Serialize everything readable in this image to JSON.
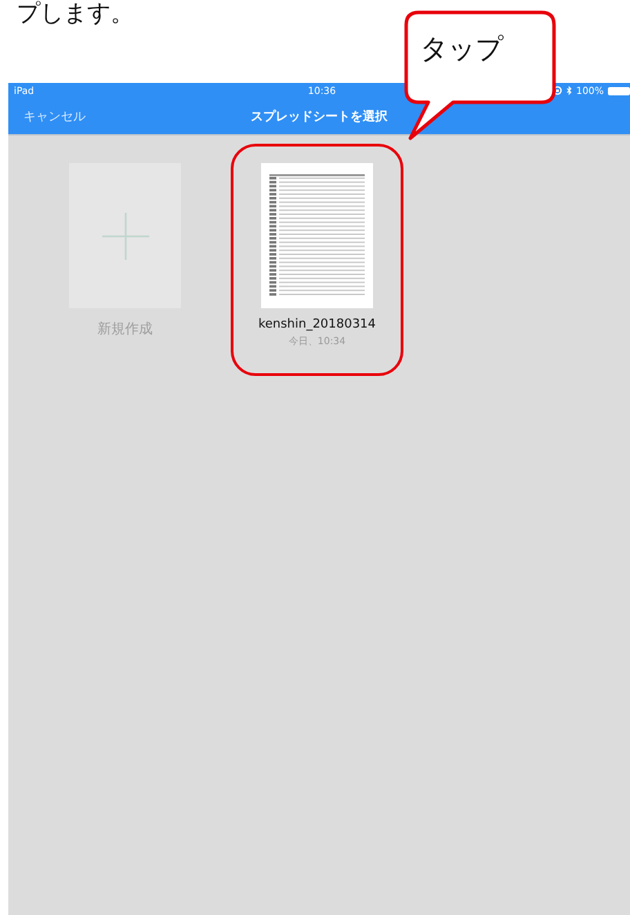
{
  "instruction": "プします。",
  "status_bar": {
    "carrier": "iPad",
    "time": "10:36",
    "battery": "100%"
  },
  "nav_bar": {
    "cancel": "キャンセル",
    "title": "スプレッドシートを選択"
  },
  "items": [
    {
      "kind": "new",
      "label": "新規作成",
      "highlighted": false
    },
    {
      "kind": "file",
      "name": "kenshin_20180314",
      "date": "今日、10:34",
      "highlighted": true
    }
  ],
  "callout": {
    "text": "タップ"
  }
}
